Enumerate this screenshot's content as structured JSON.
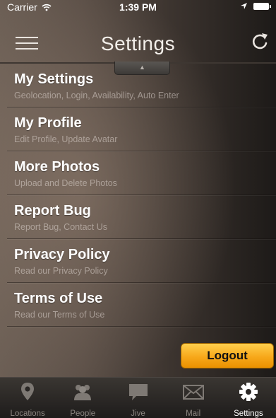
{
  "status_bar": {
    "carrier": "Carrier",
    "time": "1:39 PM"
  },
  "header": {
    "title": "Settings",
    "pull_tab_glyph": "▲",
    "menu_icon": "hamburger-menu-icon",
    "refresh_icon": "refresh-icon"
  },
  "menu": {
    "items": [
      {
        "title": "My Settings",
        "subtitle": "Geolocation, Login, Availability, Auto Enter"
      },
      {
        "title": "My Profile",
        "subtitle": "Edit Profile, Update Avatar"
      },
      {
        "title": "More Photos",
        "subtitle": "Upload and Delete Photos"
      },
      {
        "title": "Report Bug",
        "subtitle": "Report Bug, Contact Us"
      },
      {
        "title": "Privacy Policy",
        "subtitle": "Read our Privacy Policy"
      },
      {
        "title": "Terms of Use",
        "subtitle": "Read our Terms of Use"
      }
    ]
  },
  "logout": {
    "label": "Logout",
    "color": "#f7a81a"
  },
  "tabs": [
    {
      "label": "Locations",
      "icon": "location-pin-icon",
      "active": false
    },
    {
      "label": "People",
      "icon": "people-icon",
      "active": false
    },
    {
      "label": "Jive",
      "icon": "chat-bubble-icon",
      "active": false
    },
    {
      "label": "Mail",
      "icon": "mail-icon",
      "active": false
    },
    {
      "label": "Settings",
      "icon": "gear-icon",
      "active": true
    }
  ]
}
